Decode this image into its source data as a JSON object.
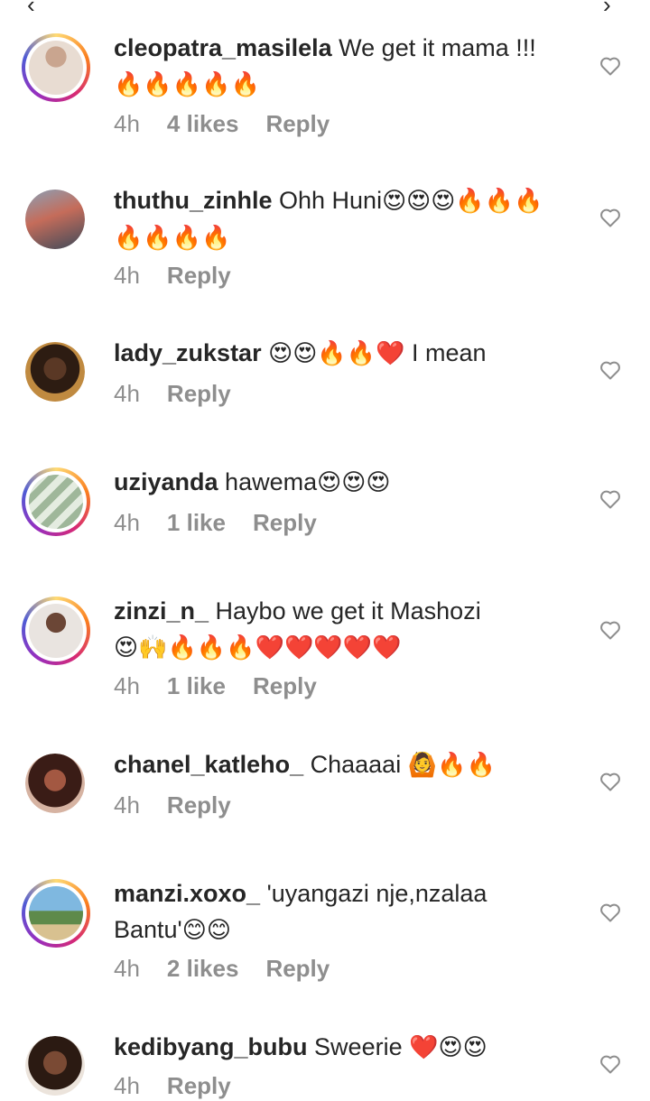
{
  "comments": [
    {
      "username": "cleopatra_masilela",
      "text": "We get it mama !!!",
      "emoji": "🔥🔥🔥🔥🔥",
      "time": "4h",
      "likes": "4 likes",
      "reply": "Reply"
    },
    {
      "username": "thuthu_zinhle",
      "text": "Ohh Huni",
      "emoji": "😍😍😍🔥🔥🔥🔥🔥🔥🔥",
      "time": "4h",
      "likes": "",
      "reply": "Reply"
    },
    {
      "username": "lady_zukstar",
      "text": "I mean",
      "emoji": "😍😍🔥🔥❤️",
      "time": "4h",
      "likes": "",
      "reply": "Reply"
    },
    {
      "username": "uziyanda",
      "text": "hawema",
      "emoji": "😍😍😍",
      "time": "4h",
      "likes": "1 like",
      "reply": "Reply"
    },
    {
      "username": "zinzi_n_",
      "text": "Haybo we get it Mashozi",
      "emoji": "😍🙌🔥🔥🔥❤️❤️❤️❤️❤️",
      "time": "4h",
      "likes": "1 like",
      "reply": "Reply"
    },
    {
      "username": "chanel_katleho_",
      "text": "Chaaaai",
      "emoji": "🙆🔥🔥",
      "time": "4h",
      "likes": "",
      "reply": "Reply"
    },
    {
      "username": "manzi.xoxo_",
      "text": "'uyangazi nje,nzalaa Bantu'",
      "emoji": "😊😊",
      "time": "4h",
      "likes": "2 likes",
      "reply": "Reply"
    },
    {
      "username": "kedibyang_bubu",
      "text": "Sweerie",
      "emoji": "❤️😍😍",
      "time": "4h",
      "likes": "",
      "reply": "Reply"
    }
  ],
  "icons": {
    "like": "heart-outline-icon"
  },
  "colors": {
    "text": "#262626",
    "meta": "#8e8e8e"
  }
}
